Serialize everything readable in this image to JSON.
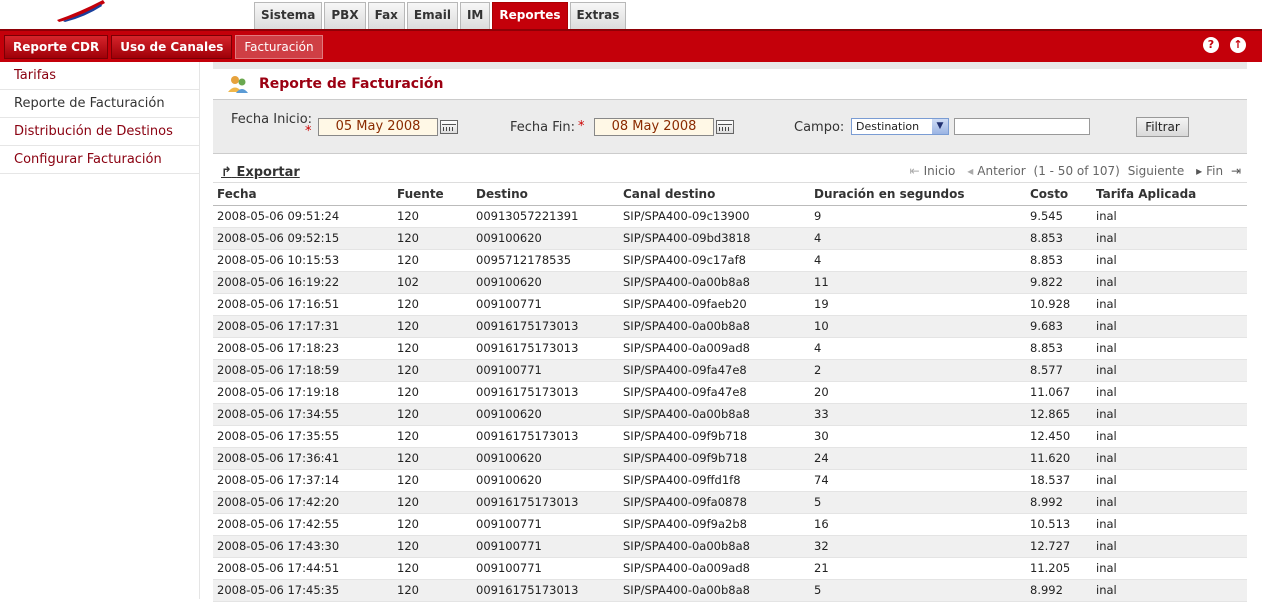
{
  "top_tabs": [
    {
      "label": "Sistema",
      "active": false
    },
    {
      "label": "PBX",
      "active": false
    },
    {
      "label": "Fax",
      "active": false
    },
    {
      "label": "Email",
      "active": false
    },
    {
      "label": "IM",
      "active": false
    },
    {
      "label": "Reportes",
      "active": true
    },
    {
      "label": "Extras",
      "active": false
    }
  ],
  "sub_tabs": [
    {
      "label": "Reporte CDR",
      "active": false
    },
    {
      "label": "Uso de Canales",
      "active": false
    },
    {
      "label": "Facturación",
      "active": true
    }
  ],
  "header_icons": [
    "help-icon",
    "logout-icon"
  ],
  "sidebar": {
    "items": [
      {
        "label": "Tarifas"
      },
      {
        "label": "Reporte de Facturación"
      },
      {
        "label": "Distribución de Destinos"
      },
      {
        "label": "Configurar Facturación"
      }
    ]
  },
  "page": {
    "title": "Reporte de Facturación"
  },
  "filter": {
    "start_label": "Fecha Inicio:",
    "required_mark": "*",
    "start_value": "05 May 2008",
    "end_label": "Fecha Fin:",
    "end_value": "08 May 2008",
    "field_label": "Campo:",
    "field_value": "Destination",
    "search_value": "",
    "filter_button": "Filtrar"
  },
  "toolbar": {
    "export_label": "Exportar",
    "first_label": "Inicio",
    "prev_label": "Anterior",
    "range_text": "(1 - 50 of 107)",
    "next_label": "Siguiente",
    "last_label": "Fin"
  },
  "table": {
    "columns": [
      "Fecha",
      "Fuente",
      "Destino",
      "Canal destino",
      "Duración en segundos",
      "Costo",
      "Tarifa Aplicada"
    ],
    "rows": [
      [
        "2008-05-06 09:51:24",
        "120",
        "00913057221391",
        "SIP/SPA400-09c13900",
        "9",
        "9.545",
        "inal"
      ],
      [
        "2008-05-06 09:52:15",
        "120",
        "009100620",
        "SIP/SPA400-09bd3818",
        "4",
        "8.853",
        "inal"
      ],
      [
        "2008-05-06 10:15:53",
        "120",
        "0095712178535",
        "SIP/SPA400-09c17af8",
        "4",
        "8.853",
        "inal"
      ],
      [
        "2008-05-06 16:19:22",
        "102",
        "009100620",
        "SIP/SPA400-0a00b8a8",
        "11",
        "9.822",
        "inal"
      ],
      [
        "2008-05-06 17:16:51",
        "120",
        "009100771",
        "SIP/SPA400-09faeb20",
        "19",
        "10.928",
        "inal"
      ],
      [
        "2008-05-06 17:17:31",
        "120",
        "00916175173013",
        "SIP/SPA400-0a00b8a8",
        "10",
        "9.683",
        "inal"
      ],
      [
        "2008-05-06 17:18:23",
        "120",
        "00916175173013",
        "SIP/SPA400-0a009ad8",
        "4",
        "8.853",
        "inal"
      ],
      [
        "2008-05-06 17:18:59",
        "120",
        "009100771",
        "SIP/SPA400-09fa47e8",
        "2",
        "8.577",
        "inal"
      ],
      [
        "2008-05-06 17:19:18",
        "120",
        "00916175173013",
        "SIP/SPA400-09fa47e8",
        "20",
        "11.067",
        "inal"
      ],
      [
        "2008-05-06 17:34:55",
        "120",
        "009100620",
        "SIP/SPA400-0a00b8a8",
        "33",
        "12.865",
        "inal"
      ],
      [
        "2008-05-06 17:35:55",
        "120",
        "00916175173013",
        "SIP/SPA400-09f9b718",
        "30",
        "12.450",
        "inal"
      ],
      [
        "2008-05-06 17:36:41",
        "120",
        "009100620",
        "SIP/SPA400-09f9b718",
        "24",
        "11.620",
        "inal"
      ],
      [
        "2008-05-06 17:37:14",
        "120",
        "009100620",
        "SIP/SPA400-09ffd1f8",
        "74",
        "18.537",
        "inal"
      ],
      [
        "2008-05-06 17:42:20",
        "120",
        "00916175173013",
        "SIP/SPA400-09fa0878",
        "5",
        "8.992",
        "inal"
      ],
      [
        "2008-05-06 17:42:55",
        "120",
        "009100771",
        "SIP/SPA400-09f9a2b8",
        "16",
        "10.513",
        "inal"
      ],
      [
        "2008-05-06 17:43:30",
        "120",
        "009100771",
        "SIP/SPA400-0a00b8a8",
        "32",
        "12.727",
        "inal"
      ],
      [
        "2008-05-06 17:44:51",
        "120",
        "009100771",
        "SIP/SPA400-0a009ad8",
        "21",
        "11.205",
        "inal"
      ],
      [
        "2008-05-06 17:45:35",
        "120",
        "00916175173013",
        "SIP/SPA400-0a00b8a8",
        "5",
        "8.992",
        "inal"
      ]
    ]
  }
}
